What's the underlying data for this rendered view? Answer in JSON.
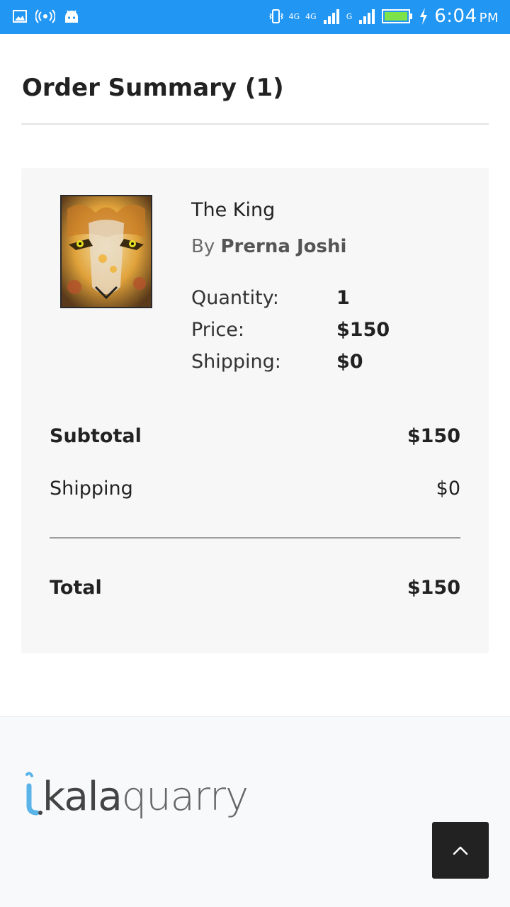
{
  "status_bar": {
    "network_1": "4G",
    "network_2": "4G",
    "network_3": "G",
    "time": "6:04",
    "ampm": "PM"
  },
  "page": {
    "title": "Order Summary (1)"
  },
  "item": {
    "name": "The King",
    "by_prefix": "By",
    "artist": "Prerna Joshi",
    "quantity_label": "Quantity:",
    "quantity_value": "1",
    "price_label": "Price:",
    "price_value": "$150",
    "shipping_label": "Shipping:",
    "shipping_value": "$0"
  },
  "summary": {
    "subtotal_label": "Subtotal",
    "subtotal_value": "$150",
    "shipping_label": "Shipping",
    "shipping_value": "$0",
    "total_label": "Total",
    "total_value": "$150"
  },
  "footer": {
    "logo_kala": "kala",
    "logo_quarry": "quarry",
    "back_to_top_icon": "chevron-up-icon"
  },
  "colors": {
    "status_bar": "#2196f3",
    "card_bg": "#f7f7f7",
    "logo_accent": "#5ab4e8",
    "button_dark": "#222222"
  }
}
